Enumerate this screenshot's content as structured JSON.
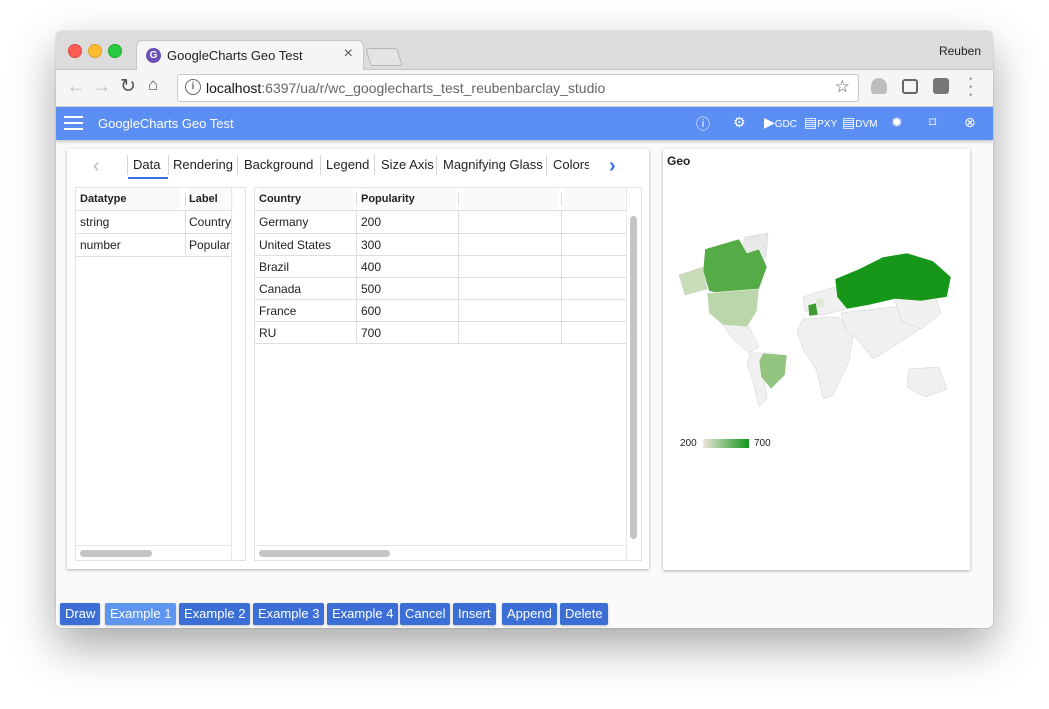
{
  "browser": {
    "tab_title": "GoogleCharts Geo Test",
    "profile": "Reuben",
    "url_host": "localhost",
    "url_rest": ":6397/ua/r/wc_googlecharts_test_reubenbarclay_studio"
  },
  "appbar": {
    "title": "GoogleCharts Geo Test",
    "gdc_label": "GDC",
    "pxy_label": "PXY",
    "dvm_label": "DVM"
  },
  "panel_tabs": [
    "Data",
    "Rendering",
    "Background",
    "Legend",
    "Size Axis",
    "Magnifying Glass",
    "Colors"
  ],
  "schema_grid": {
    "headers": [
      "Datatype",
      "Label"
    ],
    "rows": [
      [
        "string",
        "Country"
      ],
      [
        "number",
        "Popularity"
      ]
    ]
  },
  "data_grid": {
    "headers": [
      "Country",
      "Popularity",
      "",
      ""
    ],
    "rows": [
      [
        "Germany",
        "200"
      ],
      [
        "United States",
        "300"
      ],
      [
        "Brazil",
        "400"
      ],
      [
        "Canada",
        "500"
      ],
      [
        "France",
        "600"
      ],
      [
        "RU",
        "700"
      ]
    ]
  },
  "geo": {
    "title": "Geo",
    "legend_min": "200",
    "legend_max": "700",
    "color_min": "#efe6dc",
    "color_max": "#109618",
    "no_data_color": "#f5f5f5"
  },
  "chart_data": {
    "type": "geo",
    "categories": [
      "Germany",
      "United States",
      "Brazil",
      "Canada",
      "France",
      "RU"
    ],
    "values": [
      200,
      300,
      400,
      500,
      600,
      700
    ],
    "title": "Geo",
    "legend_min": 200,
    "legend_max": 700
  },
  "buttons": {
    "draw": "Draw",
    "example1": "Example 1",
    "example2": "Example 2",
    "example3": "Example 3",
    "example4": "Example 4",
    "cancel": "Cancel",
    "insert": "Insert",
    "append": "Append",
    "delete": "Delete"
  },
  "colors": {
    "appbar": "#5b8ef2",
    "button": "#3b6fd6",
    "button_selected": "#5e95ee"
  }
}
